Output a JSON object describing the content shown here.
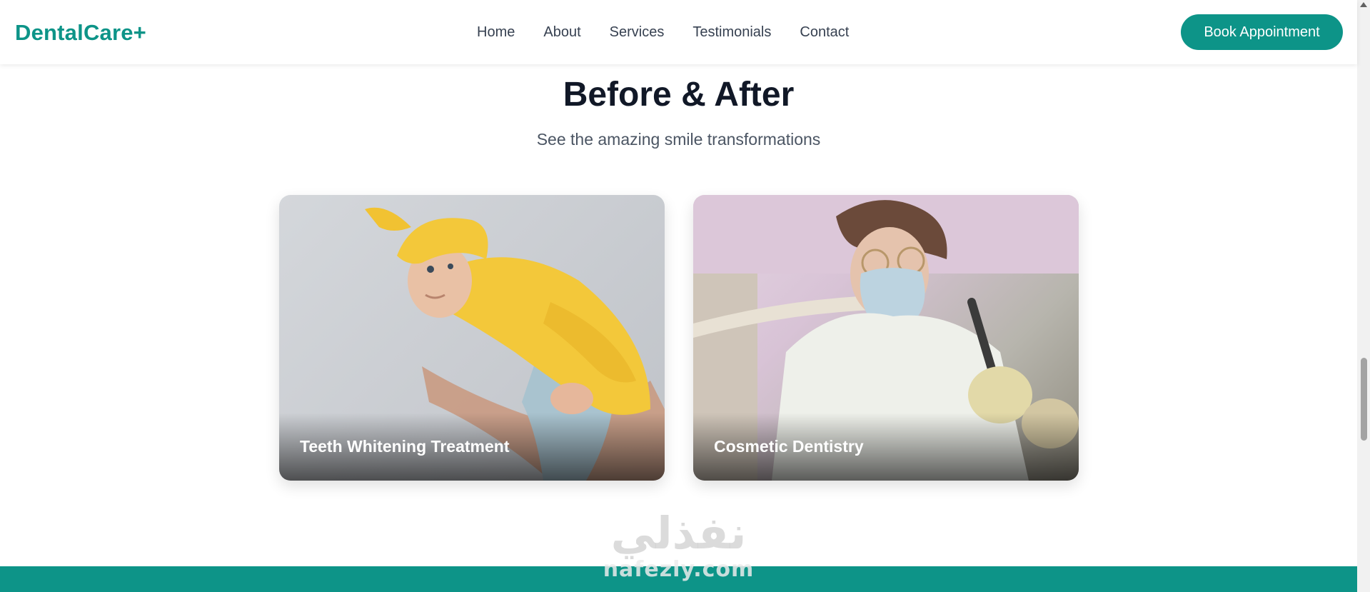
{
  "navbar": {
    "logo": "DentalCare+",
    "links": [
      "Home",
      "About",
      "Services",
      "Testimonials",
      "Contact"
    ],
    "cta_label": "Book Appointment"
  },
  "section": {
    "title": "Before & After",
    "subtitle": "See the amazing smile transformations",
    "cards": [
      {
        "label": "Teeth Whitening Treatment",
        "image": "baby-in-yellow-hat-photo"
      },
      {
        "label": "Cosmetic Dentistry",
        "image": "dentist-at-work-photo"
      }
    ]
  },
  "watermark": {
    "arabic": "نفذلي",
    "latin": "nafezly.com"
  },
  "colors": {
    "brand": "#0d9488",
    "heading": "#111827",
    "text": "#374151"
  }
}
